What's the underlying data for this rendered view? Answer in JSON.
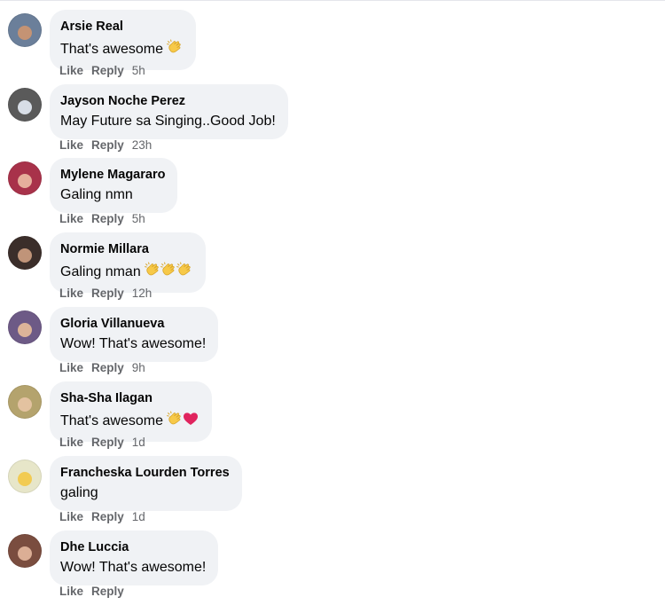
{
  "comments": [
    {
      "name": "Arsie Real",
      "text": "That's awesome",
      "emojis": [
        "clap"
      ],
      "time": "5h",
      "avatar_color": "#6b7f9a",
      "face_color": "#c99572"
    },
    {
      "name": "Jayson Noche Perez",
      "text": "May Future sa Singing..Good Job!",
      "emojis": [],
      "time": "23h",
      "avatar_color": "#5a5a5a",
      "face_color": "#dfe6ef"
    },
    {
      "name": "Mylene Magararo",
      "text": "Galing nmn",
      "emojis": [],
      "time": "5h",
      "avatar_color": "#a8324a",
      "face_color": "#e9b6a0"
    },
    {
      "name": "Normie Millara",
      "text": "Galing nman",
      "emojis": [
        "clap",
        "clap",
        "clap"
      ],
      "time": "12h",
      "avatar_color": "#3b2e2a",
      "face_color": "#c79a7d"
    },
    {
      "name": "Gloria Villanueva",
      "text": "Wow! That's awesome!",
      "emojis": [],
      "time": "9h",
      "avatar_color": "#6d5a86",
      "face_color": "#e3b99a"
    },
    {
      "name": "Sha-Sha Ilagan",
      "text": "That's awesome",
      "emojis": [
        "clap",
        "heart"
      ],
      "time": "1d",
      "avatar_color": "#b4a36d",
      "face_color": "#e6c4a3"
    },
    {
      "name": "Francheska Lourden Torres",
      "text": "galing",
      "emojis": [],
      "time": "1d",
      "avatar_color": "#e7e6c9",
      "face_color": "#f2c94c"
    },
    {
      "name": "Dhe Luccia",
      "text": "Wow! That's awesome!",
      "emojis": [],
      "time": "",
      "avatar_color": "#7a4d3f",
      "face_color": "#e0b39a"
    }
  ],
  "actions": {
    "like": "Like",
    "reply": "Reply"
  },
  "colors": {
    "bubble": "#f0f2f5",
    "meta": "#65676b",
    "heart": "#e0245e",
    "clap": "#f7c948"
  }
}
